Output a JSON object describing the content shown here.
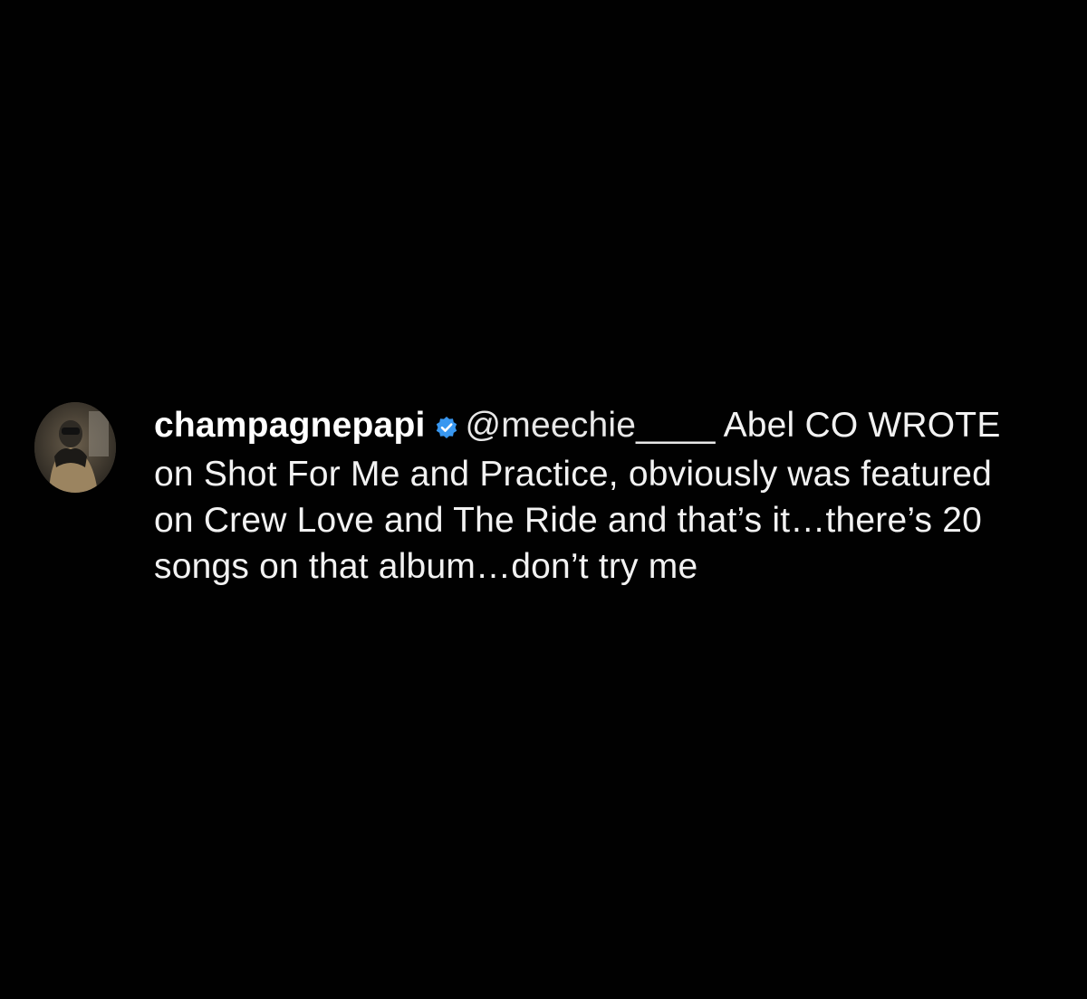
{
  "comment": {
    "username": "champagnepapi",
    "verified": true,
    "verified_icon": "verified-badge-icon",
    "mention": "@meechie____",
    "text": "Abel CO WROTE on Shot For Me and Practice, obviously was featured on Crew Love and The Ride and that’s it…there’s 20 songs on that album…don’t try me",
    "avatar_icon": "profile-avatar"
  },
  "colors": {
    "background": "#010101",
    "text": "#f2f2f2",
    "verified_badge": "#3897f0"
  }
}
